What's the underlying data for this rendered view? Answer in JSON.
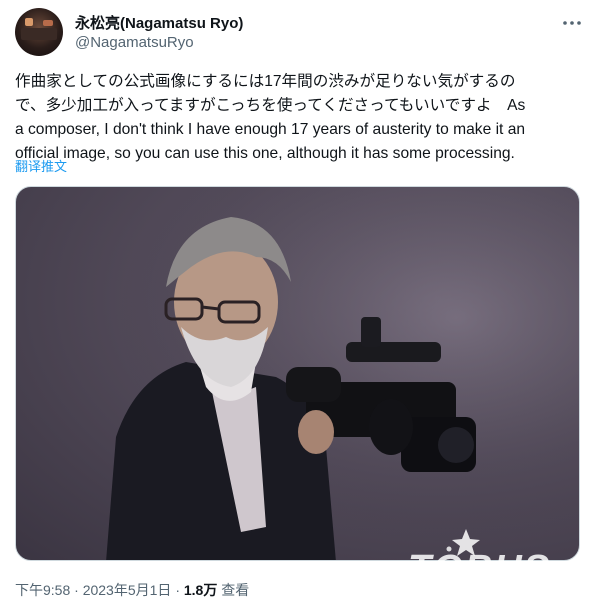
{
  "author": {
    "display_name": "永松亮(Nagamatsu Ryo)",
    "handle": "@NagamatsuRyo"
  },
  "tweet": {
    "text_lines": [
      "作曲家としての公式画像にするには17年間の渋みが足りない気がするの",
      "で、多少加工が入ってますがこっちを使ってくださってもいいですよ　As",
      "a composer, I don't think I have enough 17 years of austerity to make it an",
      "official image, so you can use this one, although it has some processing."
    ],
    "translate_label": "翻译推文"
  },
  "meta": {
    "time": "下午9:58",
    "separator": "·",
    "date": "2023年5月1日",
    "views_count": "1.8万",
    "views_label": "查看"
  },
  "watermark": "TGBUS",
  "icons": {
    "more": "more-horizontal-icon",
    "photo": "camera-man-photo"
  }
}
